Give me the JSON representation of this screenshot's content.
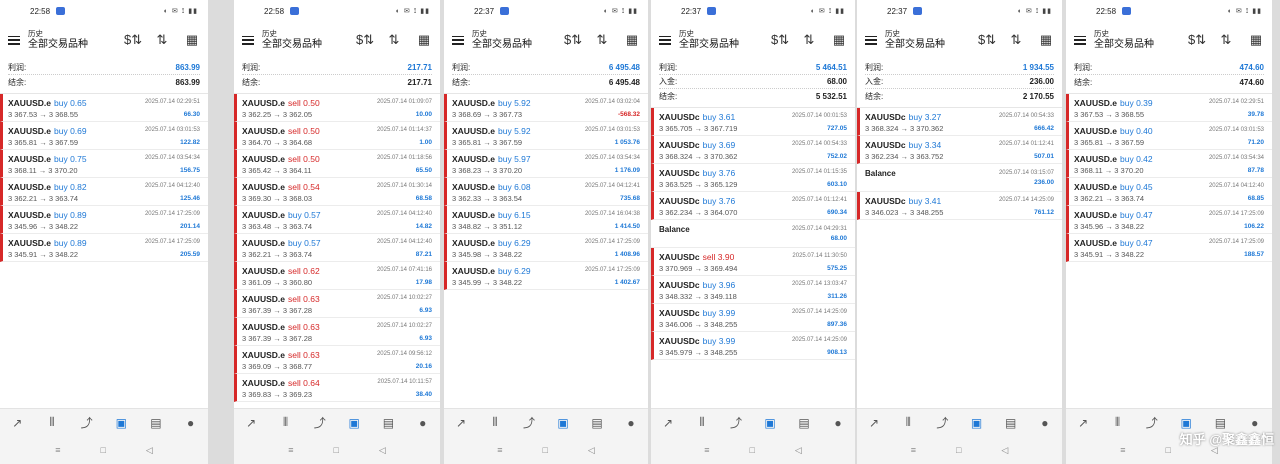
{
  "header": {
    "title_small": "历史",
    "title_main": "全部交易品种"
  },
  "labels": {
    "profit": "利润:",
    "deposit": "入金:",
    "balance": "结余:"
  },
  "watermark": "知乎 @聚鑫鑫恒",
  "screens": [
    {
      "clock": "22:58",
      "summary": [
        {
          "label": "利润:",
          "value": "863.99",
          "blue": true
        },
        {
          "label": "结余:",
          "value": "863.99",
          "blue": false
        }
      ],
      "trades": [
        {
          "symbol": "XAUUSD.e",
          "side": "buy",
          "lots": "0.65",
          "time": "2025.07.14 02:29:51",
          "price": "3 367.53 → 3 368.55",
          "profit": "66.30"
        },
        {
          "symbol": "XAUUSD.e",
          "side": "buy",
          "lots": "0.69",
          "time": "2025.07.14 03:01:53",
          "price": "3 365.81 → 3 367.59",
          "profit": "122.82"
        },
        {
          "symbol": "XAUUSD.e",
          "side": "buy",
          "lots": "0.75",
          "time": "2025.07.14 03:54:34",
          "price": "3 368.11 → 3 370.20",
          "profit": "156.75"
        },
        {
          "symbol": "XAUUSD.e",
          "side": "buy",
          "lots": "0.82",
          "time": "2025.07.14 04:12:40",
          "price": "3 362.21 → 3 363.74",
          "profit": "125.46"
        },
        {
          "symbol": "XAUUSD.e",
          "side": "buy",
          "lots": "0.89",
          "time": "2025.07.14 17:25:09",
          "price": "3 345.96 → 3 348.22",
          "profit": "201.14"
        },
        {
          "symbol": "XAUUSD.e",
          "side": "buy",
          "lots": "0.89",
          "time": "2025.07.14 17:25:09",
          "price": "3 345.91 → 3 348.22",
          "profit": "205.59"
        }
      ]
    },
    {
      "clock": "22:58",
      "summary": [
        {
          "label": "利润:",
          "value": "217.71",
          "blue": true
        },
        {
          "label": "结余:",
          "value": "217.71",
          "blue": false
        }
      ],
      "trades": [
        {
          "symbol": "XAUUSD.e",
          "side": "sell",
          "lots": "0.50",
          "time": "2025.07.14 01:09:07",
          "price": "3 362.25 → 3 362.05",
          "profit": "10.00"
        },
        {
          "symbol": "XAUUSD.e",
          "side": "sell",
          "lots": "0.50",
          "time": "2025.07.14 01:14:37",
          "price": "3 364.70 → 3 364.68",
          "profit": "1.00"
        },
        {
          "symbol": "XAUUSD.e",
          "side": "sell",
          "lots": "0.50",
          "time": "2025.07.14 01:18:56",
          "price": "3 365.42 → 3 364.11",
          "profit": "65.50"
        },
        {
          "symbol": "XAUUSD.e",
          "side": "sell",
          "lots": "0.54",
          "time": "2025.07.14 01:30:14",
          "price": "3 369.30 → 3 368.03",
          "profit": "68.58"
        },
        {
          "symbol": "XAUUSD.e",
          "side": "buy",
          "lots": "0.57",
          "time": "2025.07.14 04:12:40",
          "price": "3 363.48 → 3 363.74",
          "profit": "14.82"
        },
        {
          "symbol": "XAUUSD.e",
          "side": "buy",
          "lots": "0.57",
          "time": "2025.07.14 04:12:40",
          "price": "3 362.21 → 3 363.74",
          "profit": "87.21"
        },
        {
          "symbol": "XAUUSD.e",
          "side": "sell",
          "lots": "0.62",
          "time": "2025.07.14 07:41:16",
          "price": "3 361.09 → 3 360.80",
          "profit": "17.98"
        },
        {
          "symbol": "XAUUSD.e",
          "side": "sell",
          "lots": "0.63",
          "time": "2025.07.14 10:02:27",
          "price": "3 367.39 → 3 367.28",
          "profit": "6.93"
        },
        {
          "symbol": "XAUUSD.e",
          "side": "sell",
          "lots": "0.63",
          "time": "2025.07.14 10:02:27",
          "price": "3 367.39 → 3 367.28",
          "profit": "6.93"
        },
        {
          "symbol": "XAUUSD.e",
          "side": "sell",
          "lots": "0.63",
          "time": "2025.07.14 09:56:12",
          "price": "3 369.09 → 3 368.77",
          "profit": "20.16"
        },
        {
          "symbol": "XAUUSD.e",
          "side": "sell",
          "lots": "0.64",
          "time": "2025.07.14 10:11:57",
          "price": "3 369.83 → 3 369.23",
          "profit": "38.40"
        }
      ]
    },
    {
      "clock": "22:37",
      "summary": [
        {
          "label": "利润:",
          "value": "6 495.48",
          "blue": true
        },
        {
          "label": "结余:",
          "value": "6 495.48",
          "blue": false
        }
      ],
      "trades": [
        {
          "symbol": "XAUUSD.e",
          "side": "buy",
          "lots": "5.92",
          "time": "2025.07.14 03:02:04",
          "price": "3 368.69 → 3 367.73",
          "profit": "-568.32",
          "neg": true
        },
        {
          "symbol": "XAUUSD.e",
          "side": "buy",
          "lots": "5.92",
          "time": "2025.07.14 03:01:53",
          "price": "3 365.81 → 3 367.59",
          "profit": "1 053.76"
        },
        {
          "symbol": "XAUUSD.e",
          "side": "buy",
          "lots": "5.97",
          "time": "2025.07.14 03:54:34",
          "price": "3 368.23 → 3 370.20",
          "profit": "1 176.09"
        },
        {
          "symbol": "XAUUSD.e",
          "side": "buy",
          "lots": "6.08",
          "time": "2025.07.14 04:12:41",
          "price": "3 362.33 → 3 363.54",
          "profit": "735.68"
        },
        {
          "symbol": "XAUUSD.e",
          "side": "buy",
          "lots": "6.15",
          "time": "2025.07.14 16:04:38",
          "price": "3 348.82 → 3 351.12",
          "profit": "1 414.50"
        },
        {
          "symbol": "XAUUSD.e",
          "side": "buy",
          "lots": "6.29",
          "time": "2025.07.14 17:25:09",
          "price": "3 345.98 → 3 348.22",
          "profit": "1 408.96"
        },
        {
          "symbol": "XAUUSD.e",
          "side": "buy",
          "lots": "6.29",
          "time": "2025.07.14 17:25:09",
          "price": "3 345.99 → 3 348.22",
          "profit": "1 402.67"
        }
      ]
    },
    {
      "clock": "22:37",
      "summary": [
        {
          "label": "利润:",
          "value": "5 464.51",
          "blue": true
        },
        {
          "label": "入金:",
          "value": "68.00",
          "blue": false
        },
        {
          "label": "结余:",
          "value": "5 532.51",
          "blue": false
        }
      ],
      "trades": [
        {
          "symbol": "XAUUSDc",
          "side": "buy",
          "lots": "3.61",
          "time": "2025.07.14 00:01:53",
          "price": "3 365.705 → 3 367.719",
          "profit": "727.05"
        },
        {
          "symbol": "XAUUSDc",
          "side": "buy",
          "lots": "3.69",
          "time": "2025.07.14 00:54:33",
          "price": "3 368.324 → 3 370.362",
          "profit": "752.02"
        },
        {
          "symbol": "XAUUSDc",
          "side": "buy",
          "lots": "3.76",
          "time": "2025.07.14 01:15:35",
          "price": "3 363.525 → 3 365.129",
          "profit": "603.10"
        },
        {
          "symbol": "XAUUSDc",
          "side": "buy",
          "lots": "3.76",
          "time": "2025.07.14 01:12:41",
          "price": "3 362.234 → 3 364.070",
          "profit": "690.34"
        },
        {
          "balance": true,
          "label": "Balance",
          "time": "2025.07.14 04:29:31",
          "profit": "68.00"
        },
        {
          "symbol": "XAUUSDc",
          "side": "sell",
          "lots": "3.90",
          "time": "2025.07.14 11:30:50",
          "price": "3 370.969 → 3 369.494",
          "profit": "575.25"
        },
        {
          "symbol": "XAUUSDc",
          "side": "buy",
          "lots": "3.96",
          "time": "2025.07.14 13:03:47",
          "price": "3 348.332 → 3 349.118",
          "profit": "311.26"
        },
        {
          "symbol": "XAUUSDc",
          "side": "buy",
          "lots": "3.99",
          "time": "2025.07.14 14:25:09",
          "price": "3 346.006 → 3 348.255",
          "profit": "897.36"
        },
        {
          "symbol": "XAUUSDc",
          "side": "buy",
          "lots": "3.99",
          "time": "2025.07.14 14:25:09",
          "price": "3 345.979 → 3 348.255",
          "profit": "908.13"
        }
      ]
    },
    {
      "clock": "22:37",
      "summary": [
        {
          "label": "利润:",
          "value": "1 934.55",
          "blue": true
        },
        {
          "label": "入金:",
          "value": "236.00",
          "blue": false
        },
        {
          "label": "结余:",
          "value": "2 170.55",
          "blue": false
        }
      ],
      "trades": [
        {
          "symbol": "XAUUSDc",
          "side": "buy",
          "lots": "3.27",
          "time": "2025.07.14 00:54:33",
          "price": "3 368.324 → 3 370.362",
          "profit": "666.42"
        },
        {
          "symbol": "XAUUSDc",
          "side": "buy",
          "lots": "3.34",
          "time": "2025.07.14 01:12:41",
          "price": "3 362.234 → 3 363.752",
          "profit": "507.01"
        },
        {
          "balance": true,
          "label": "Balance",
          "time": "2025.07.14 03:15:07",
          "profit": "236.00"
        },
        {
          "symbol": "XAUUSDc",
          "side": "buy",
          "lots": "3.41",
          "time": "2025.07.14 14:25:09",
          "price": "3 346.023 → 3 348.255",
          "profit": "761.12"
        }
      ]
    },
    {
      "clock": "22:58",
      "summary": [
        {
          "label": "利润:",
          "value": "474.60",
          "blue": true
        },
        {
          "label": "结余:",
          "value": "474.60",
          "blue": false
        }
      ],
      "trades": [
        {
          "symbol": "XAUUSD.e",
          "side": "buy",
          "lots": "0.39",
          "time": "2025.07.14 02:29:51",
          "price": "3 367.53 → 3 368.55",
          "profit": "39.78"
        },
        {
          "symbol": "XAUUSD.e",
          "side": "buy",
          "lots": "0.40",
          "time": "2025.07.14 03:01:53",
          "price": "3 365.81 → 3 367.59",
          "profit": "71.20"
        },
        {
          "symbol": "XAUUSD.e",
          "side": "buy",
          "lots": "0.42",
          "time": "2025.07.14 03:54:34",
          "price": "3 368.11 → 3 370.20",
          "profit": "87.78"
        },
        {
          "symbol": "XAUUSD.e",
          "side": "buy",
          "lots": "0.45",
          "time": "2025.07.14 04:12:40",
          "price": "3 362.21 → 3 363.74",
          "profit": "68.85"
        },
        {
          "symbol": "XAUUSD.e",
          "side": "buy",
          "lots": "0.47",
          "time": "2025.07.14 17:25:09",
          "price": "3 345.96 → 3 348.22",
          "profit": "106.22"
        },
        {
          "symbol": "XAUUSD.e",
          "side": "buy",
          "lots": "0.47",
          "time": "2025.07.14 17:25:09",
          "price": "3 345.91 → 3 348.22",
          "profit": "188.57"
        }
      ]
    }
  ]
}
